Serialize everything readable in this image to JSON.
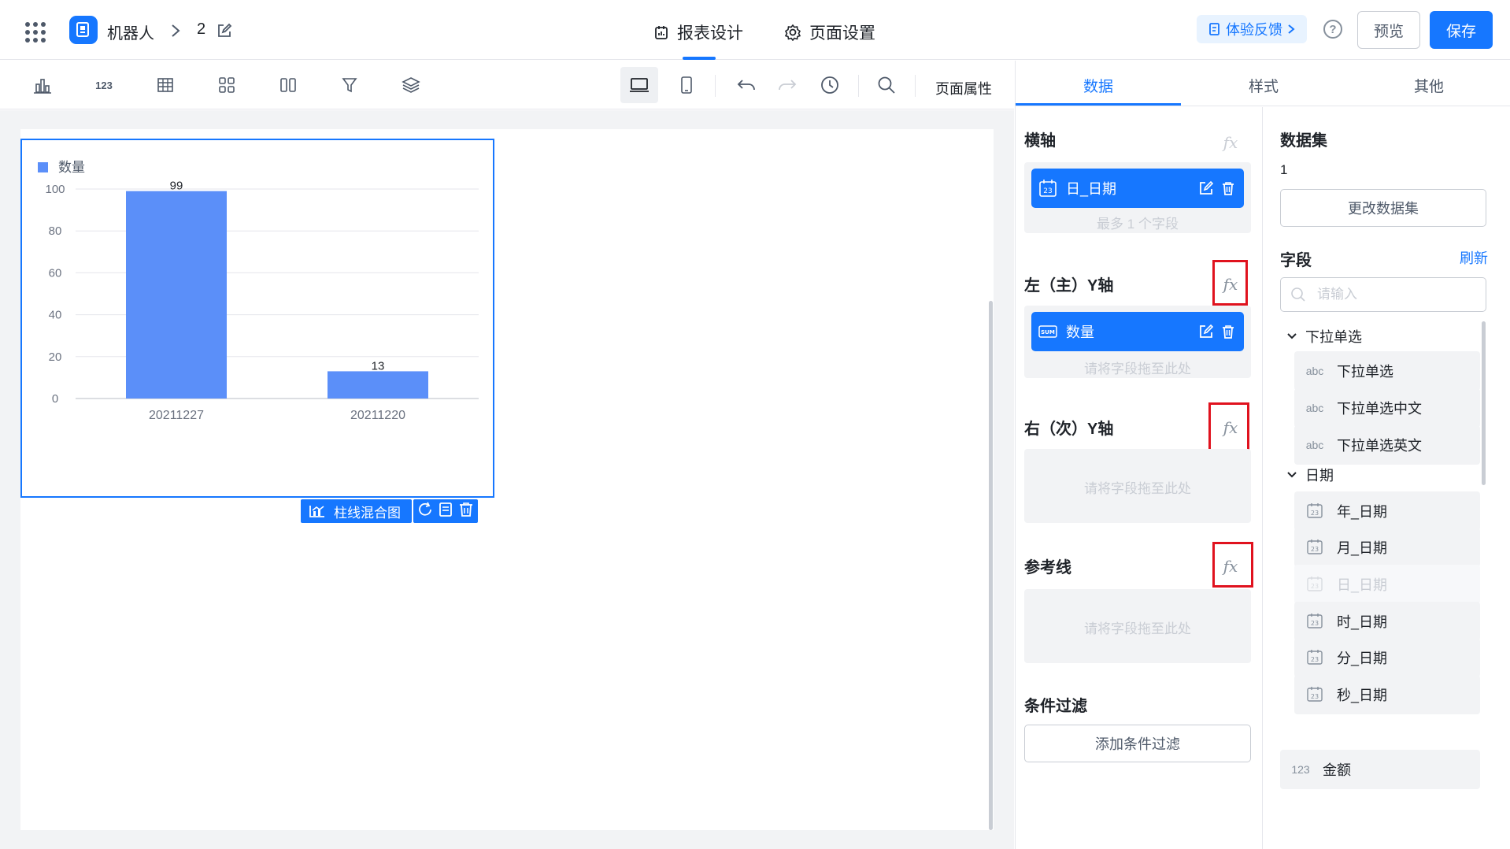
{
  "header": {
    "app_name": "机器人",
    "page_name": "2",
    "tabs": [
      {
        "label": "报表设计",
        "active": true
      },
      {
        "label": "页面设置",
        "active": false
      }
    ],
    "feedback_label": "体验反馈",
    "preview_label": "预览",
    "save_label": "保存",
    "accent_color": "#1677ff"
  },
  "toolbar": {
    "page_properties_label": "页面属性",
    "icons": [
      "bar-chart-icon",
      "number-icon",
      "table-icon",
      "grid-layout-icon",
      "columns-icon",
      "filter-icon",
      "layers-icon",
      "desktop-icon",
      "mobile-icon",
      "undo-icon",
      "redo-icon",
      "history-icon",
      "search-icon"
    ]
  },
  "chart_widget": {
    "type_label": "柱线混合图",
    "actions": [
      "refresh-icon",
      "copy-icon",
      "delete-icon"
    ]
  },
  "chart_data": {
    "type": "bar",
    "categories": [
      "20211227",
      "20211220"
    ],
    "series": [
      {
        "name": "数量",
        "values": [
          99,
          13
        ],
        "color": "#5b8ff9"
      }
    ],
    "data_labels": [
      "99",
      "13"
    ],
    "ylim": [
      0,
      100
    ],
    "yticks": [
      "0",
      "20",
      "40",
      "60",
      "80",
      "100"
    ],
    "grid": true,
    "legend_position": "top-left"
  },
  "right_panel": {
    "tabs": [
      {
        "label": "数据",
        "active": true
      },
      {
        "label": "样式",
        "active": false
      },
      {
        "label": "其他",
        "active": false
      }
    ],
    "x_axis": {
      "title": "横轴",
      "field": "日_日期",
      "hint": "最多 1 个字段"
    },
    "left_y_axis": {
      "title": "左（主）Y轴",
      "field": "数量",
      "hint": "请将字段拖至此处"
    },
    "right_y_axis": {
      "title": "右（次）Y轴",
      "hint": "请将字段拖至此处"
    },
    "reference_line": {
      "title": "参考线",
      "hint": "请将字段拖至此处"
    },
    "condition_filter": {
      "title": "条件过滤",
      "button": "添加条件过滤"
    },
    "fx_label": "fx",
    "dataset": {
      "title": "数据集",
      "value": "1",
      "change_button": "更改数据集"
    },
    "fields": {
      "title": "字段",
      "refresh": "刷新",
      "search_placeholder": "请输入",
      "groups": [
        {
          "name": "下拉单选",
          "items": [
            {
              "tag": "abc",
              "name": "下拉单选"
            },
            {
              "tag": "abc",
              "name": "下拉单选中文"
            },
            {
              "tag": "abc",
              "name": "下拉单选英文"
            }
          ]
        },
        {
          "name": "日期",
          "items": [
            {
              "tag": "date",
              "name": "年_日期"
            },
            {
              "tag": "date",
              "name": "月_日期"
            },
            {
              "tag": "date",
              "name": "日_日期",
              "disabled": true
            },
            {
              "tag": "date",
              "name": "时_日期"
            },
            {
              "tag": "date",
              "name": "分_日期"
            },
            {
              "tag": "date",
              "name": "秒_日期"
            }
          ]
        }
      ],
      "number_field": {
        "tag": "123",
        "name": "金额"
      }
    }
  }
}
